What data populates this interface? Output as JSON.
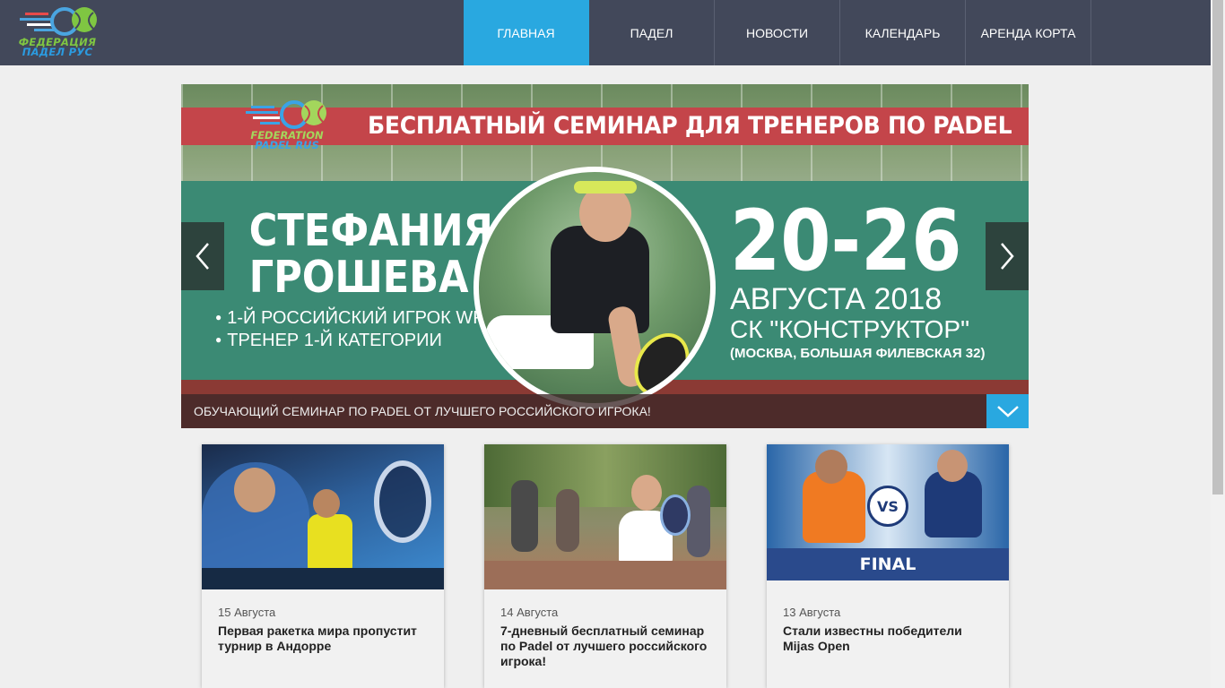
{
  "brand": {
    "logo_line1": "ФЕДЕРАЦИЯ",
    "logo_line2": "ПАДЕЛ РУС",
    "colors": {
      "header_bg": "#42485a",
      "accent": "#29a8e0"
    }
  },
  "nav": {
    "items": [
      {
        "label": "ГЛАВНАЯ",
        "active": true
      },
      {
        "label": "ПАДЕЛ",
        "active": false
      },
      {
        "label": "НОВОСТИ",
        "active": false
      },
      {
        "label": "КАЛЕНДАРЬ",
        "active": false
      },
      {
        "label": "АРЕНДА КОРТА",
        "active": false
      }
    ]
  },
  "slider": {
    "banner_title": "БЕСПЛАТНЫЙ СЕМИНАР ДЛЯ ТРЕНЕРОВ ПО PADEL",
    "logo_line1": "FEDERATION",
    "logo_line2": "PADEL RUS",
    "name_line1": "СТЕФАНИЯ",
    "name_line2": "ГРОШЕВА",
    "bullet1": "1-Й РОССИЙСКИЙ ИГРОК WPT",
    "bullet2": "ТРЕНЕР 1-Й КАТЕГОРИИ",
    "dates": "20-26",
    "month": "АВГУСТА 2018",
    "venue": "СК \"КОНСТРУКТОР\"",
    "address": "(МОСКВА, БОЛЬШАЯ ФИЛЕВСКАЯ 32)",
    "caption": "ОБУЧАЮЩИЙ СЕМИНАР ПО PADEL ОТ ЛУЧШЕГО РОССИЙСКОГО ИГРОКА!"
  },
  "news": [
    {
      "date": "15 Августа",
      "title": "Первая ракетка мира пропустит турнир в Андорре"
    },
    {
      "date": "14 Августа",
      "title": "7-дневный бесплатный семинар по Padel от лучшего российского игрока!"
    },
    {
      "date": "13 Августа",
      "title": "Стали известны победители Mijas Open",
      "img_vs": "VS",
      "img_final": "FINAL"
    }
  ]
}
